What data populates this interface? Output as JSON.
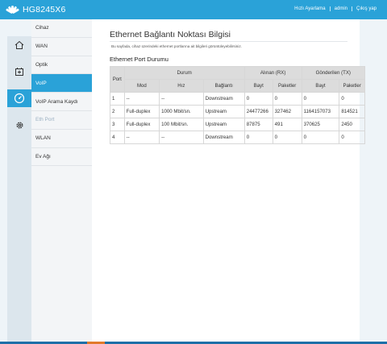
{
  "header": {
    "brand": "HG8245X6",
    "links": [
      "Hızlı Ayarlama",
      "admin",
      "Çıkış yap"
    ]
  },
  "icon_rail": [
    "home-icon",
    "add-box-icon",
    "gauge-icon",
    "gear-icon"
  ],
  "menu": {
    "items": [
      {
        "label": "Cihaz"
      },
      {
        "label": "WAN"
      },
      {
        "label": "Optik"
      },
      {
        "label": "VoIP"
      },
      {
        "label": "VoIP Arama Kaydı"
      },
      {
        "label": "Eth Port"
      },
      {
        "label": "WLAN"
      },
      {
        "label": "Ev Ağı"
      }
    ],
    "active": "VoIP",
    "selected_sub": "Eth Port"
  },
  "content": {
    "title": "Ethernet Bağlantı Noktası Bilgisi",
    "description": "Bu sayfada, cihaz üzerindeki ethernet portlarına ait bilgileri görüntüleyebilirsiniz.",
    "section_title": "Ethernet Port Durumu"
  },
  "table": {
    "headers": {
      "port": "Port",
      "durum": "Durum",
      "rx": "Alınan (RX)",
      "tx": "Gönderilen (TX)",
      "mod": "Mod",
      "hiz": "Hız",
      "baglanti": "Bağlantı",
      "rx_bayt": "Bayt",
      "rx_paket": "Paketler",
      "tx_bayt": "Bayt",
      "tx_paket": "Paketler"
    },
    "rows": [
      [
        "1",
        "--",
        "--",
        "Downstream",
        "0",
        "0",
        "0",
        "0"
      ],
      [
        "2",
        "Full-duplex",
        "1000 Mbit/sn.",
        "Upstream",
        "24477266",
        "327462",
        "1164157073",
        "814521"
      ],
      [
        "3",
        "Full-duplex",
        "100 Mbit/sn.",
        "Upstream",
        "87875",
        "491",
        "370625",
        "2450"
      ],
      [
        "4",
        "--",
        "--",
        "Downstream",
        "0",
        "0",
        "0",
        "0"
      ]
    ]
  },
  "colors": {
    "accent": "#2aa2d8",
    "rail": "#dce6ed",
    "header_cell": "#dcdcdc"
  }
}
